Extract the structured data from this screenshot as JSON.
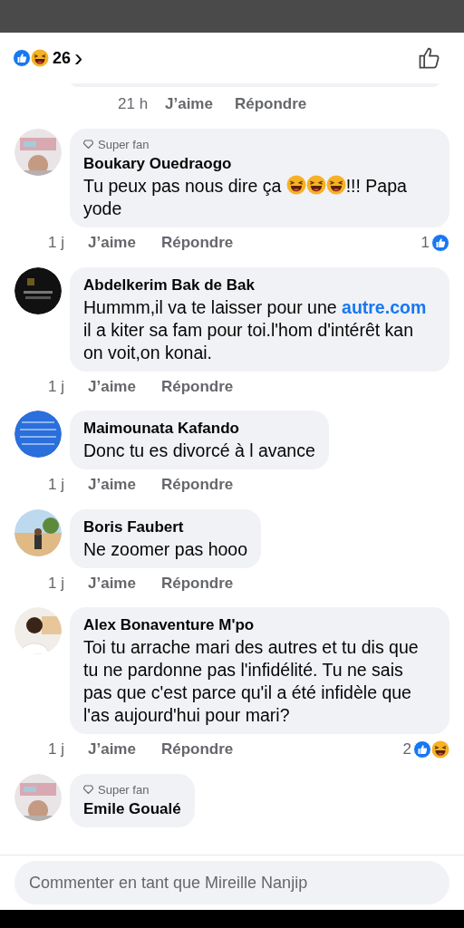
{
  "header": {
    "reactions": [
      {
        "kind": "like"
      },
      {
        "kind": "haha"
      }
    ],
    "count": "26",
    "chevron": "›"
  },
  "previous_comment": {
    "time": "21 h",
    "like": "J’aime",
    "reply": "Répondre"
  },
  "comments": [
    {
      "badge": "Super fan",
      "author": "Boukary Ouedraogo",
      "avatar": {
        "kind": "picture"
      },
      "body": [
        {
          "kind": "text",
          "text": "Tu peux pas nous dire ça "
        },
        {
          "kind": "laugh"
        },
        {
          "kind": "laugh"
        },
        {
          "kind": "laugh"
        },
        {
          "kind": "text",
          "text": "!!! Papa yode"
        }
      ],
      "time": "1 j",
      "like": "J’aime",
      "reply": "Répondre",
      "reaction_count": "1",
      "reactions": [
        {
          "kind": "like"
        }
      ]
    },
    {
      "author": "Abdelkerim Bak de Bak",
      "avatar": {
        "kind": "picture"
      },
      "body": [
        {
          "kind": "text",
          "text": "Hummm,il va te laisser pour une "
        },
        {
          "kind": "link",
          "text": "autre.com"
        },
        {
          "kind": "text",
          "text": " il a kiter sa fam pour toi.l'hom d'intérêt kan on voit,on konai."
        }
      ],
      "time": "1 j",
      "like": "J’aime",
      "reply": "Répondre"
    },
    {
      "author": "Maimounata Kafando",
      "avatar": {
        "kind": "picture"
      },
      "body": [
        {
          "kind": "text",
          "text": "Donc tu es divorcé à l avance"
        }
      ],
      "time": "1 j",
      "like": "J’aime",
      "reply": "Répondre"
    },
    {
      "author": "Boris Faubert",
      "avatar": {
        "kind": "picture"
      },
      "body": [
        {
          "kind": "text",
          "text": "Ne zoomer pas hooo"
        }
      ],
      "time": "1 j",
      "like": "J’aime",
      "reply": "Répondre"
    },
    {
      "author": "Alex Bonaventure M'po",
      "avatar": {
        "kind": "picture"
      },
      "body": [
        {
          "kind": "text",
          "text": "Toi tu arrache mari des autres et tu dis que tu ne pardonne pas l'infidélité. Tu ne sais pas que c'est parce qu'il a été infidèle que l'as aujourd'hui pour mari?"
        }
      ],
      "time": "1 j",
      "like": "J’aime",
      "reply": "Répondre",
      "reaction_count": "2",
      "reactions": [
        {
          "kind": "like"
        },
        {
          "kind": "haha"
        }
      ]
    },
    {
      "badge": "Super fan",
      "author": "Emile Goualé",
      "avatar": {
        "kind": "picture"
      }
    }
  ],
  "composer": {
    "placeholder": "Commenter en tant que Mireille Nanjip"
  }
}
